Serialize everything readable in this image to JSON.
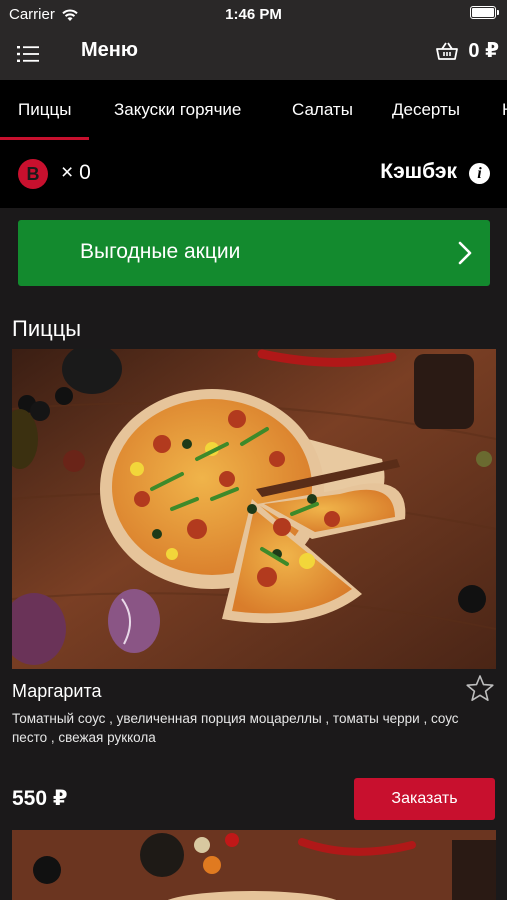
{
  "status_bar": {
    "carrier": "Carrier",
    "time": "1:46 PM"
  },
  "nav": {
    "title": "Меню",
    "cart_total": "0 ₽"
  },
  "tabs": [
    {
      "label": "Пиццы",
      "active": true
    },
    {
      "label": "Закуски горячие",
      "active": false
    },
    {
      "label": "Салаты",
      "active": false
    },
    {
      "label": "Десерты",
      "active": false
    },
    {
      "label": "Н",
      "active": false
    }
  ],
  "bonus": {
    "icon_letter": "B",
    "count": "× 0"
  },
  "cashback": {
    "label": "Кэшбэк",
    "info_glyph": "i"
  },
  "promo": {
    "label": "Выгодные акции"
  },
  "section": {
    "title": "Пиццы"
  },
  "products": [
    {
      "name": "Маргарита",
      "description": "Томатный соус , увеличенная порция моцареллы , томаты черри , соус песто , свежая руккола",
      "price": "550 ₽",
      "order_label": "Заказать",
      "favorite": false
    }
  ],
  "colors": {
    "accent": "#c8102e",
    "promo_green": "#138a2e",
    "background": "#1b191a",
    "bar": "#2a2828"
  }
}
